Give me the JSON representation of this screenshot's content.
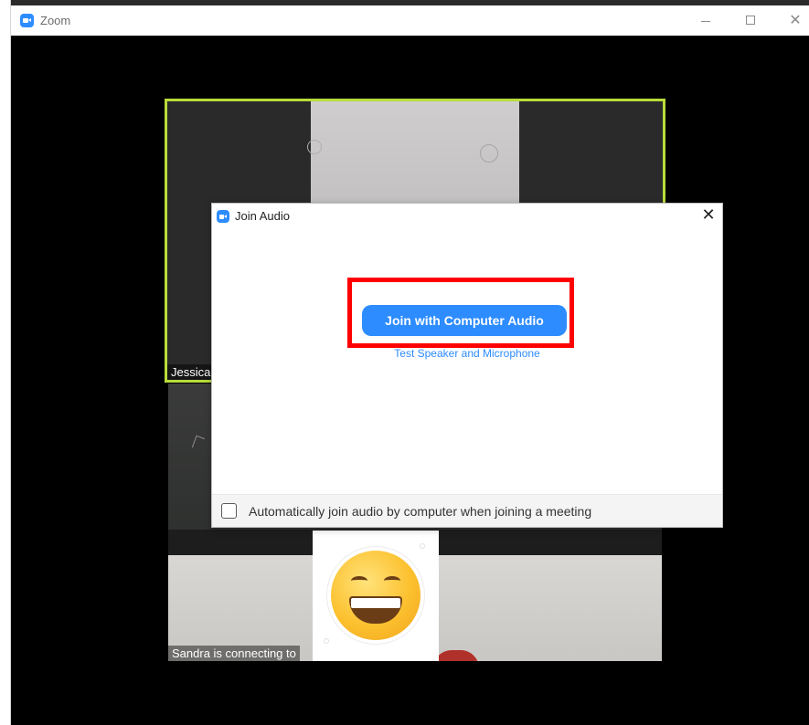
{
  "window": {
    "title": "Zoom",
    "controls": {
      "minimize": "—",
      "maximize": "□",
      "close": "✕"
    }
  },
  "participants": [
    {
      "label": "Jessica"
    },
    {
      "label": "Sandra is connecting to"
    }
  ],
  "dialog": {
    "title": "Join Audio",
    "close_icon": "✕",
    "primary_button": "Join with Computer Audio",
    "test_link": "Test Speaker and Microphone",
    "auto_join_label": "Automatically join audio by computer when joining a meeting",
    "auto_join_checked": false
  },
  "colors": {
    "brand_blue": "#2d8cff",
    "active_speaker_border": "#b8dc3a",
    "highlight": "#ff0000"
  },
  "icons": [
    "zoom-logo-icon",
    "minimize-icon",
    "maximize-icon",
    "close-icon",
    "grinning-face-emoji-icon"
  ]
}
